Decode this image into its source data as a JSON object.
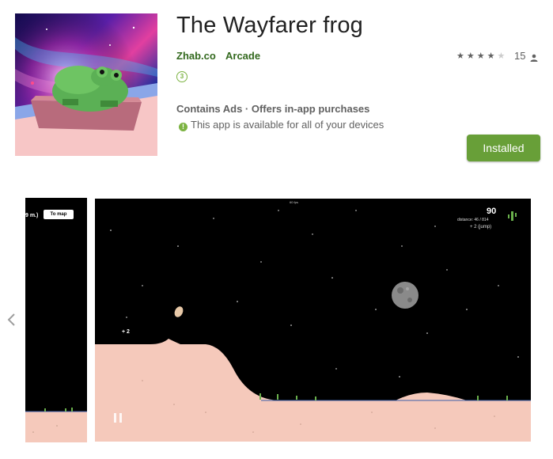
{
  "app": {
    "title": "The Wayfarer frog",
    "developer": "Zhab.co",
    "genre": "Arcade",
    "rating_count": "15",
    "rating_stars": 4,
    "content_rating": "3",
    "ads_info": "Contains Ads · Offers in-app purchases",
    "availability": "This app is available for all of your devices",
    "install_label": "Installed"
  },
  "icons": {
    "star": "star-icon",
    "person": "person-icon",
    "info": "info-icon",
    "prev": "chevron-left-icon",
    "pause": "pause-icon"
  },
  "colors": {
    "accent": "#689f38",
    "link": "#33691e",
    "ground": "#f5c9bb"
  },
  "screenshots": {
    "shot1": {
      "distance_text": "9 m.)",
      "map_button": "To map"
    },
    "shot2": {
      "fps_text": "60 fps",
      "score": "90",
      "distance_text": "distance: 46 / 814",
      "bonus_text": "+ 2 (jump)",
      "plus_text": "+ 2"
    }
  }
}
